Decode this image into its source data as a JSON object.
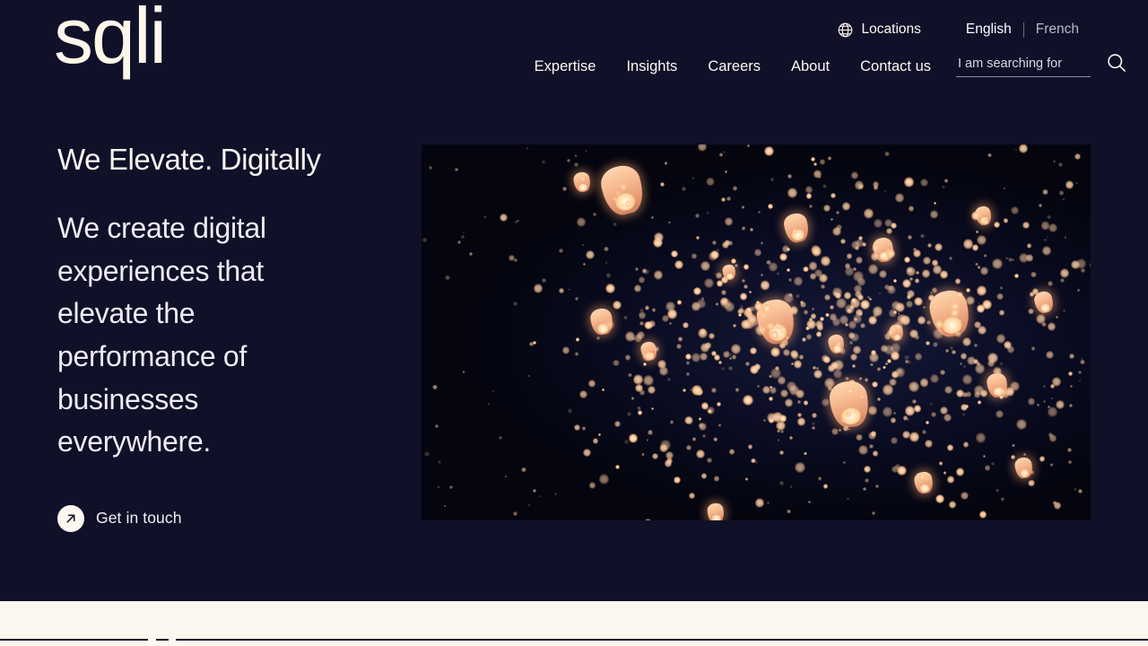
{
  "brand": {
    "logo_text": "sqli"
  },
  "topbar": {
    "locations_label": "Locations",
    "locations_icon": "globe-icon",
    "languages": [
      {
        "label": "English",
        "active": true
      },
      {
        "label": "French",
        "active": false
      }
    ]
  },
  "nav": {
    "items": [
      {
        "label": "Expertise"
      },
      {
        "label": "Insights"
      },
      {
        "label": "Careers"
      },
      {
        "label": "About"
      },
      {
        "label": "Contact us"
      }
    ],
    "search": {
      "placeholder": "I am searching for",
      "value": "",
      "icon": "search-icon"
    }
  },
  "hero": {
    "title": "We Elevate. Digitally",
    "subtitle": "We create digital experiences that elevate the performance of businesses everywhere.",
    "cta": {
      "label": "Get in touch",
      "icon": "arrow-up-right-icon"
    },
    "image": {
      "alt": "Sky lanterns glowing in a dark night sky"
    }
  },
  "colors": {
    "background_dark": "#101029",
    "background_cream": "#fdf8ef",
    "text_light": "#fdf8ef",
    "lantern_glow": "#ffc08a",
    "rule": "#13132b"
  }
}
